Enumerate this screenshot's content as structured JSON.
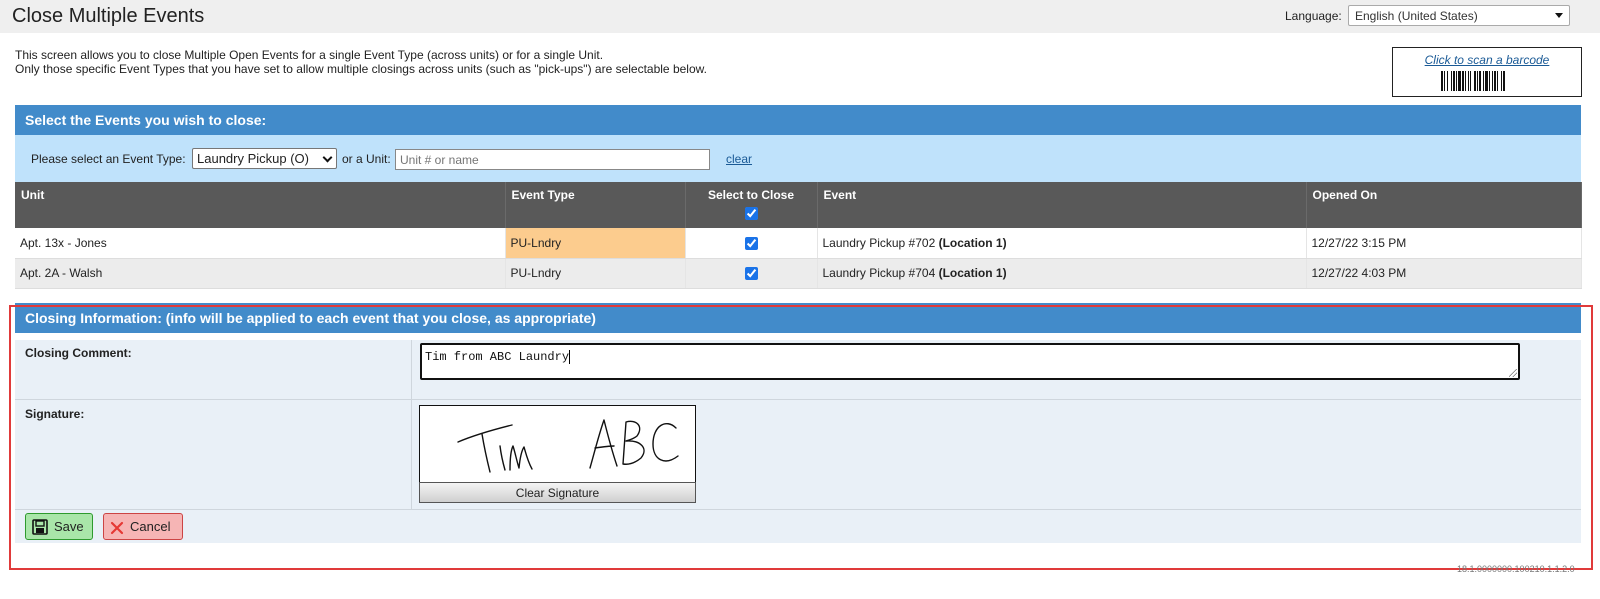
{
  "header": {
    "title": "Close Multiple Events",
    "language_label": "Language:",
    "language_value": "English (United States)"
  },
  "intro": {
    "line1": "This screen allows you to close Multiple Open Events for a single Event Type (across units) or for a single Unit.",
    "line2": "Only those specific Event Types that you have set to allow multiple closings across units (such as \"pick-ups\") are selectable below."
  },
  "barcode": {
    "link_text": "Click to scan a barcode"
  },
  "select_section": {
    "title": "Select the Events you wish to close:",
    "event_type_label": "Please select an Event Type:",
    "event_type_value": "Laundry Pickup (O)",
    "unit_label": "or a Unit:",
    "unit_placeholder": "Unit # or name",
    "clear_label": "clear"
  },
  "table": {
    "headers": {
      "unit": "Unit",
      "event_type": "Event Type",
      "select": "Select to Close",
      "event": "Event",
      "opened": "Opened On"
    },
    "select_all_checked": true,
    "rows": [
      {
        "unit": "Apt. 13x - Jones",
        "event_type": "PU-Lndry",
        "checked": true,
        "event": "Laundry Pickup #702",
        "location": "(Location 1)",
        "opened": "12/27/22 3:15 PM"
      },
      {
        "unit": "Apt. 2A - Walsh",
        "event_type": "PU-Lndry",
        "checked": true,
        "event": "Laundry Pickup #704",
        "location": "(Location 1)",
        "opened": "12/27/22 4:03 PM"
      }
    ]
  },
  "closing": {
    "title": "Closing Information: (info will be applied to each event that you close, as appropriate)",
    "comment_label": "Closing Comment:",
    "comment_value": "Tim from ABC Laundry",
    "signature_label": "Signature:",
    "clear_signature": "Clear Signature",
    "save": "Save",
    "cancel": "Cancel"
  },
  "footer": {
    "version": "18.1.0000000.100210.1.1.2.0"
  },
  "colors": {
    "section_blue": "#428bca",
    "filter_blue": "#bfe2fb",
    "table_header": "#595959",
    "event_type_cell": "#fccc8e",
    "highlight_frame": "#e03a3a"
  }
}
